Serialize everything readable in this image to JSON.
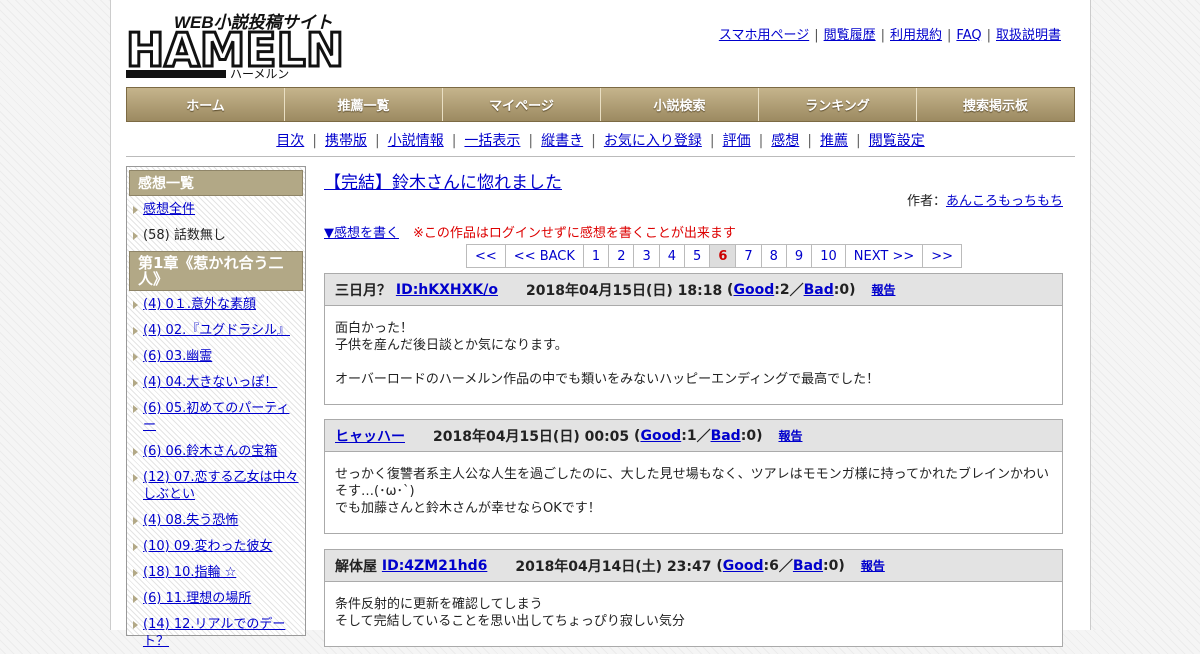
{
  "logo": {
    "top_text": "WEB小説投稿サイト",
    "main_text": "HAMELN",
    "kana": "ハーメルン"
  },
  "top_links": [
    "スマホ用ページ",
    "閲覧履歴",
    "利用規約",
    "FAQ",
    "取扱説明書"
  ],
  "global_nav": [
    "ホーム",
    "推薦一覧",
    "マイページ",
    "小説検索",
    "ランキング",
    "捜索掲示板"
  ],
  "sub_nav": [
    "目次",
    "携帯版",
    "小説情報",
    "一括表示",
    "縦書き",
    "お気に入り登録",
    "評価",
    "感想",
    "推薦",
    "閲覧設定"
  ],
  "sidebar": {
    "heading": "感想一覧",
    "all_link": "感想全件",
    "no_episode": "(58) 話数無し",
    "chapter_heading": "第1章《惹かれ合う二人》",
    "episodes": [
      "(4) 0１.意外な素顔",
      "(4) 02.『ユグドラシル』",
      "(6) 03.幽霊",
      "(4) 04.大きないっぽ！",
      "(6) 05.初めてのパーティー",
      "(6) 06.鈴木さんの宝箱",
      "(12) 07.恋する乙女は中々しぶとい",
      "(4) 08.失う恐怖",
      "(10) 09.変わった彼女",
      "(18) 10.指輪 ☆",
      "(6) 11.理想の場所",
      "(14) 12.リアルでのデート？"
    ]
  },
  "main": {
    "title": "【完結】鈴木さんに惚れました",
    "author_label": "作者：",
    "author_name": "あんころもっちもち",
    "write_link": "▼感想を書く",
    "warning": "※この作品はログインせずに感想を書くことが出来ます",
    "pager": {
      "first": "<<",
      "back": "<< BACK",
      "pages": [
        "1",
        "2",
        "3",
        "4",
        "5",
        "6",
        "7",
        "8",
        "9",
        "10"
      ],
      "current": "6",
      "next": "NEXT >>",
      "last": ">>"
    },
    "reviews": [
      {
        "name": "三日月？",
        "id": "ID:hKXHXK/o",
        "date": "2018年04月15日(日) 18:18",
        "good_count": "2",
        "bad_count": "0",
        "lines": [
          "面白かった！",
          "子供を産んだ後日談とか気になります。",
          "",
          "オーバーロードのハーメルン作品の中でも類いをみないハッピーエンディングで最高でした！"
        ]
      },
      {
        "name": "ヒャッハー",
        "id": "",
        "date": "2018年04月15日(日) 00:05",
        "good_count": "1",
        "bad_count": "0",
        "lines": [
          "せっかく復讐者系主人公な人生を過ごしたのに、大した見せ場もなく、ツアレはモモンガ様に持ってかれたブレインかわいそす…(･ω･`)",
          "でも加藤さんと鈴木さんが幸せならOKです！"
        ]
      },
      {
        "name": "解体屋",
        "id": "ID:4ZM21hd6",
        "date": "2018年04月14日(土) 23:47",
        "good_count": "6",
        "bad_count": "0",
        "lines": [
          "条件反射的に更新を確認してしまう",
          "そして完結していることを思い出してちょっぴり寂しい気分"
        ]
      }
    ],
    "good_label": "Good",
    "bad_label": "Bad",
    "report_label": "報告"
  }
}
